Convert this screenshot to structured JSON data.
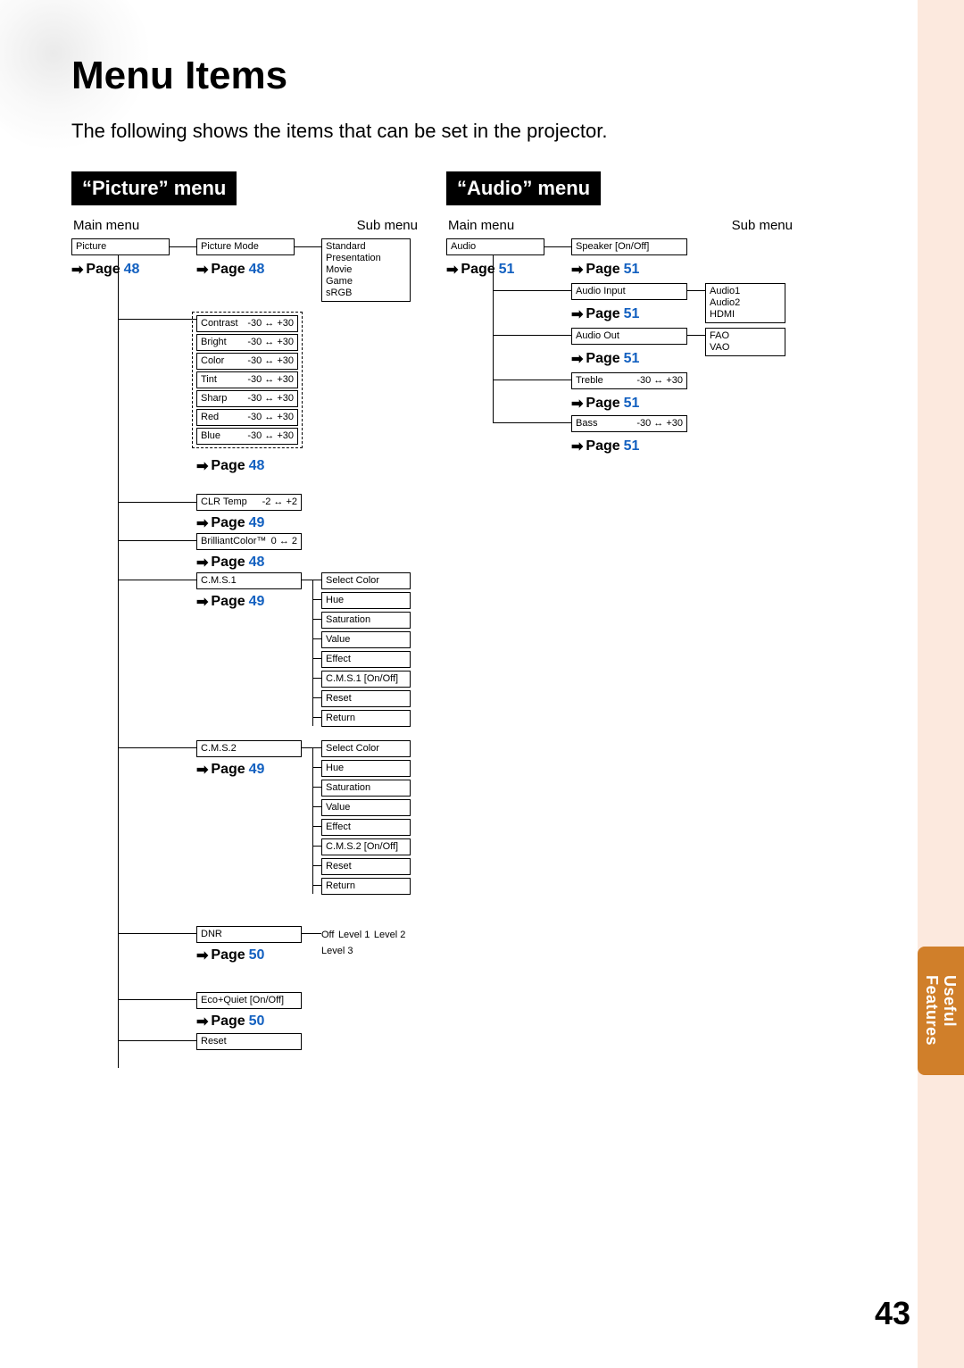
{
  "title": "Menu Items",
  "intro": "The following shows the items that can be set in the projector.",
  "side_tab": "Useful\nFeatures",
  "page_number": "43",
  "labels": {
    "main": "Main menu",
    "sub": "Sub menu"
  },
  "page_label": "Page",
  "picture": {
    "header": "“Picture” menu",
    "main": "Picture",
    "picture_mode_label": "Picture Mode",
    "picture_mode_page": "48",
    "main_page": "48",
    "picture_modes": [
      "Standard",
      "Presentation",
      "Movie",
      "Game",
      "sRGB"
    ],
    "adjust_page": "48",
    "adjust": [
      {
        "name": "Contrast",
        "range": "-30 ↔ +30"
      },
      {
        "name": "Bright",
        "range": "-30 ↔ +30"
      },
      {
        "name": "Color",
        "range": "-30 ↔ +30"
      },
      {
        "name": "Tint",
        "range": "-30 ↔ +30"
      },
      {
        "name": "Sharp",
        "range": "-30 ↔ +30"
      },
      {
        "name": "Red",
        "range": "-30 ↔ +30"
      },
      {
        "name": "Blue",
        "range": "-30 ↔ +30"
      }
    ],
    "clr_temp": {
      "name": "CLR Temp",
      "range": "-2 ↔ +2",
      "page": "49"
    },
    "brilliant": {
      "name": "BrilliantColor™",
      "range": "0 ↔ 2",
      "page": "48"
    },
    "cms1": {
      "label": "C.M.S.1",
      "page": "49",
      "items": [
        "Select Color",
        "Hue",
        "Saturation",
        "Value",
        "Effect",
        "C.M.S.1 [On/Off]",
        "Reset",
        "Return"
      ]
    },
    "cms2": {
      "label": "C.M.S.2",
      "page": "49",
      "items": [
        "Select Color",
        "Hue",
        "Saturation",
        "Value",
        "Effect",
        "C.M.S.2 [On/Off]",
        "Reset",
        "Return"
      ]
    },
    "dnr": {
      "label": "DNR",
      "page": "50",
      "options": [
        "Off",
        "Level 1",
        "Level 2",
        "Level 3"
      ]
    },
    "eco": {
      "label": "Eco+Quiet [On/Off]",
      "page": "50"
    },
    "reset": {
      "label": "Reset"
    }
  },
  "audio": {
    "header": "“Audio” menu",
    "main": "Audio",
    "main_page": "51",
    "speaker": {
      "label": "Speaker [On/Off]",
      "page": "51"
    },
    "audio_input": {
      "label": "Audio Input",
      "page": "51",
      "options": [
        "Audio1",
        "Audio2",
        "HDMI"
      ]
    },
    "audio_out": {
      "label": "Audio Out",
      "page": "51",
      "options": [
        "FAO",
        "VAO"
      ]
    },
    "treble": {
      "name": "Treble",
      "range": "-30 ↔ +30",
      "page": "51"
    },
    "bass": {
      "name": "Bass",
      "range": "-30 ↔ +30",
      "page": "51"
    }
  }
}
